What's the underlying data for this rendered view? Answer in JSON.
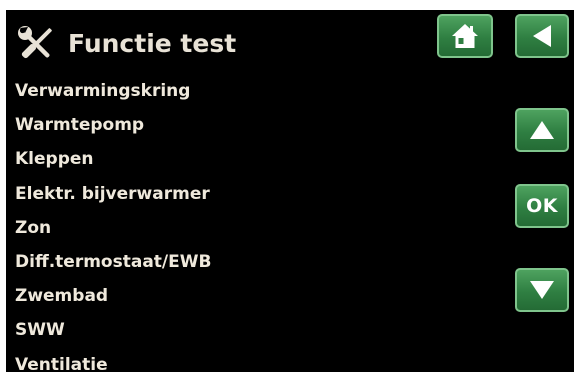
{
  "header": {
    "title": "Functie test",
    "title_icon": "tools-icon"
  },
  "nav": {
    "home_icon": "home-icon",
    "back_icon": "back-arrow-icon",
    "up_icon": "arrow-up-icon",
    "ok_label": "OK",
    "down_icon": "arrow-down-icon"
  },
  "menu": {
    "items": [
      {
        "label": "Verwarmingskring"
      },
      {
        "label": "Warmtepomp"
      },
      {
        "label": "Kleppen"
      },
      {
        "label": "Elektr. bijverwarmer"
      },
      {
        "label": "Zon"
      },
      {
        "label": "Diff.termostaat/EWB"
      },
      {
        "label": "Zwembad"
      },
      {
        "label": "SWW"
      },
      {
        "label": "Ventilatie"
      }
    ]
  },
  "colors": {
    "background": "#000000",
    "text": "#efe9dc",
    "button_green": "#2f7f42",
    "button_border": "#7fc48c"
  }
}
